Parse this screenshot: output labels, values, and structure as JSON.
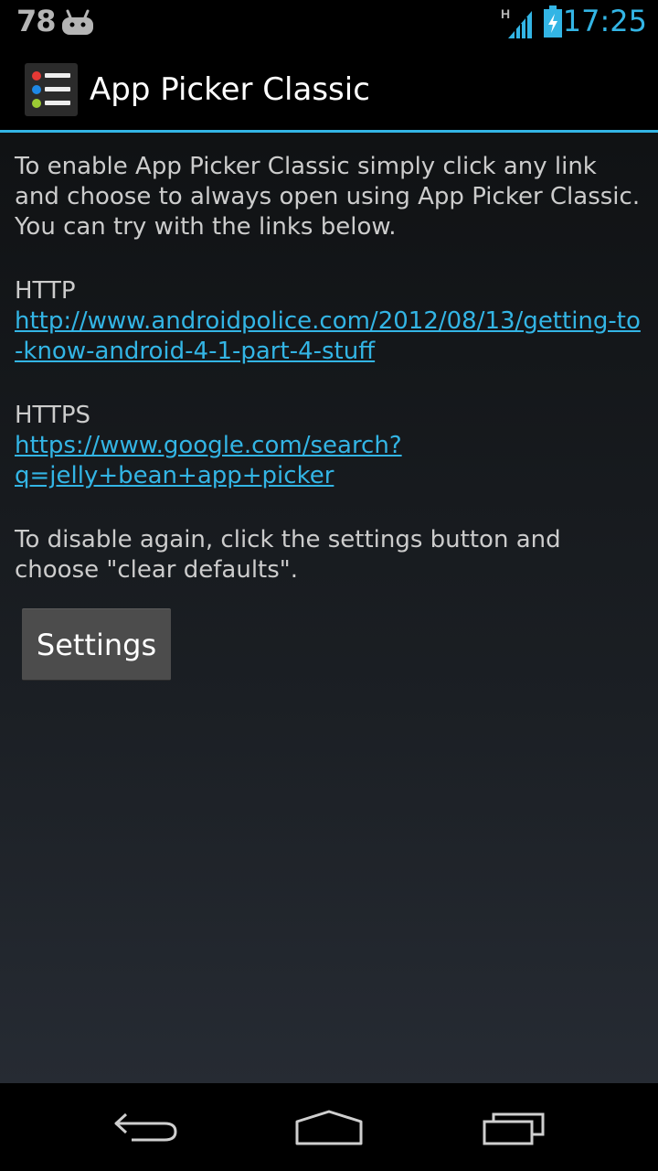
{
  "status_bar": {
    "notification_count": "78",
    "network_type": "H",
    "time": "17:25",
    "icons": [
      "android-notification-icon",
      "signal-icon",
      "battery-charging-icon"
    ]
  },
  "action_bar": {
    "title": "App Picker Classic",
    "icon": "app-list-icon"
  },
  "content": {
    "intro": "To enable App Picker Classic simply click any link and choose to always open using App Picker Classic. You can try with the links below.",
    "http_label": "HTTP",
    "http_link": "http://www.androidpolice.com/2012/08/13/getting-to-know-android-4-1-part-4-stuff",
    "https_label": "HTTPS",
    "https_link": "https://www.google.com/search?q=jelly+bean+app+picker",
    "disable_text": "To disable again, click the settings button and choose \"clear defaults\".",
    "settings_button": "Settings"
  },
  "navigation": {
    "buttons": [
      "back-icon",
      "home-icon",
      "recent-apps-icon"
    ]
  },
  "colors": {
    "accent": "#33b5e5",
    "text": "#cccccc",
    "button": "#4c4c4c"
  }
}
